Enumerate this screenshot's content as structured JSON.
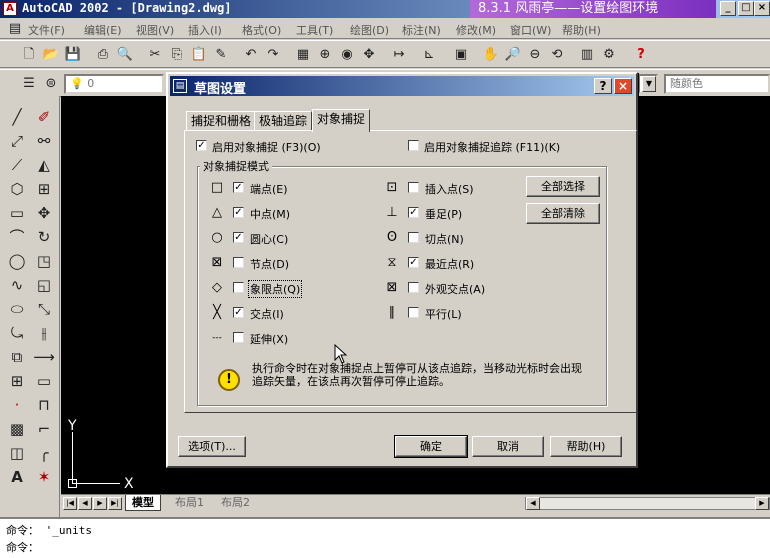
{
  "window": {
    "title": "AutoCAD 2002 - [Drawing2.dwg]",
    "overlay_caption": "8.3.1 风雨亭——设置绘图环境",
    "app_icon": "A",
    "min": "_",
    "max": "□"
  },
  "menubar": [
    "文件(F)",
    "编辑(E)",
    "视图(V)",
    "插入(I)",
    "格式(O)",
    "工具(T)",
    "绘图(D)",
    "标注(N)",
    "修改(M)",
    "窗口(W)",
    "帮助(H)"
  ],
  "toolbar": {
    "layer_combo": "0",
    "color_combo": "随颜色"
  },
  "layout_tabs": [
    "模型",
    "布局1",
    "布局2"
  ],
  "command": {
    "line1": "命令： '_units",
    "line2": "命令："
  },
  "ucs": {
    "x": "X",
    "y": "Y"
  },
  "dialog": {
    "title": "草图设置",
    "help_btn": "?",
    "close_btn": "×",
    "tabs": [
      "捕捉和栅格",
      "极轴追踪",
      "对象捕捉"
    ],
    "enable_snap": "启用对象捕捉 (F3)(O)",
    "enable_tracking": "启用对象捕捉追踪 (F11)(K)",
    "group_title": "对象捕捉模式",
    "left_modes": [
      {
        "sym": "□",
        "label": "端点(E)",
        "checked": true
      },
      {
        "sym": "△",
        "label": "中点(M)",
        "checked": true
      },
      {
        "sym": "○",
        "label": "圆心(C)",
        "checked": true
      },
      {
        "sym": "⊠",
        "label": "节点(D)",
        "checked": false
      },
      {
        "sym": "◇",
        "label": "象限点(Q)",
        "checked": false
      },
      {
        "sym": "╳",
        "label": "交点(I)",
        "checked": true
      },
      {
        "sym": "---",
        "label": "延伸(X)",
        "checked": false
      }
    ],
    "right_modes": [
      {
        "sym": "⊡",
        "label": "插入点(S)",
        "checked": false
      },
      {
        "sym": "⊥",
        "label": "垂足(P)",
        "checked": true
      },
      {
        "sym": "ʘ",
        "label": "切点(N)",
        "checked": false
      },
      {
        "sym": "⧖",
        "label": "最近点(R)",
        "checked": true
      },
      {
        "sym": "⊠",
        "label": "外观交点(A)",
        "checked": false
      },
      {
        "sym": "∥",
        "label": "平行(L)",
        "checked": false
      }
    ],
    "select_all": "全部选择",
    "clear_all": "全部清除",
    "hint": "执行命令时在对象捕捉点上暂停可从该点追踪，当移动光标时会出现追踪矢量，在该点再次暂停可停止追踪。",
    "options": "选项(T)...",
    "ok": "确定",
    "cancel": "取消",
    "help": "帮助(H)"
  }
}
